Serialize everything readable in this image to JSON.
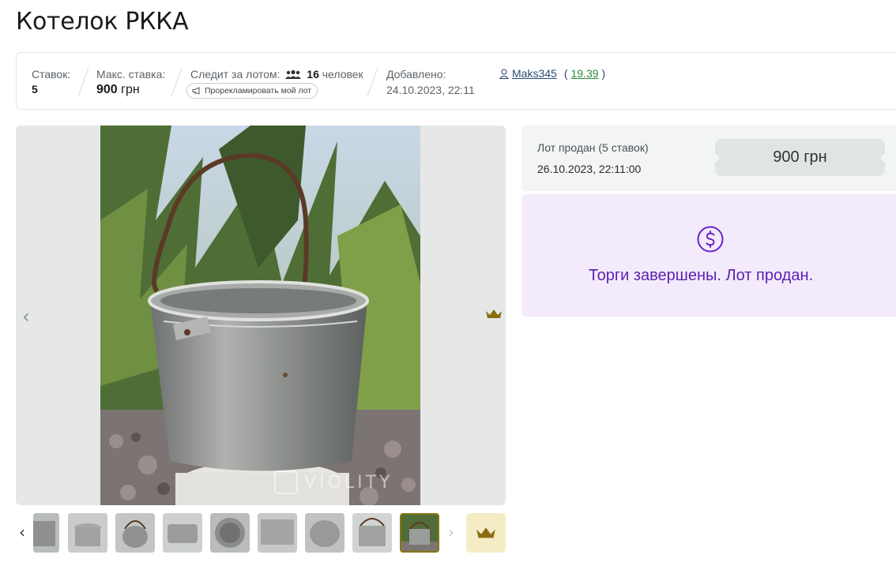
{
  "page": {
    "title": "Котелок РККА"
  },
  "info": {
    "bids_label": "Ставок:",
    "bids_value": "5",
    "max_bid_label": "Макс. ставка:",
    "max_bid_amount": "900",
    "max_bid_currency": "грн",
    "followers_label": "Следит за лотом:",
    "followers_count": "16",
    "followers_unit": "человек",
    "promote_label": "Прорекламировать мой лот",
    "added_label": "Добавлено:",
    "added_date": "24.10.2023, 22:11",
    "seller_name": "Maks345",
    "seller_rating": "19.39"
  },
  "gallery": {
    "watermark": "VIOLITY",
    "thumbnail_count": 9,
    "active_thumbnail": 9
  },
  "sale": {
    "sold_label": "Лот продан (5 ставок)",
    "sold_date": "26.10.2023, 22:11:00",
    "price": "900 грн",
    "status_text": "Торги завершены. Лот продан.",
    "status_color": "#5a1fb0",
    "status_bg": "#f3ebfb"
  },
  "icons": {
    "people": "people-icon",
    "megaphone": "megaphone-icon",
    "user": "user-icon",
    "crown": "crown-icon",
    "dollar": "dollar-circle-icon"
  }
}
